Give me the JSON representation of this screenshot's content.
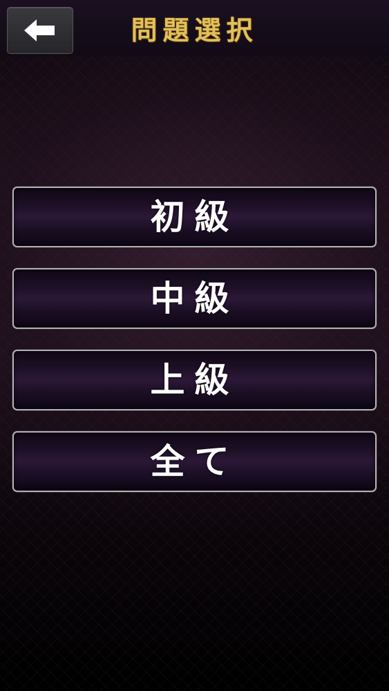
{
  "header": {
    "title": "問題選択",
    "back_icon": "arrow-left-icon"
  },
  "menu": {
    "items": [
      {
        "label": "初級"
      },
      {
        "label": "中級"
      },
      {
        "label": "上級"
      },
      {
        "label": "全て"
      }
    ]
  },
  "colors": {
    "title_gold": "#e2c05c",
    "button_border": "#b8b0b8",
    "button_fill": "#2b1838",
    "label_white": "#ffffff"
  }
}
